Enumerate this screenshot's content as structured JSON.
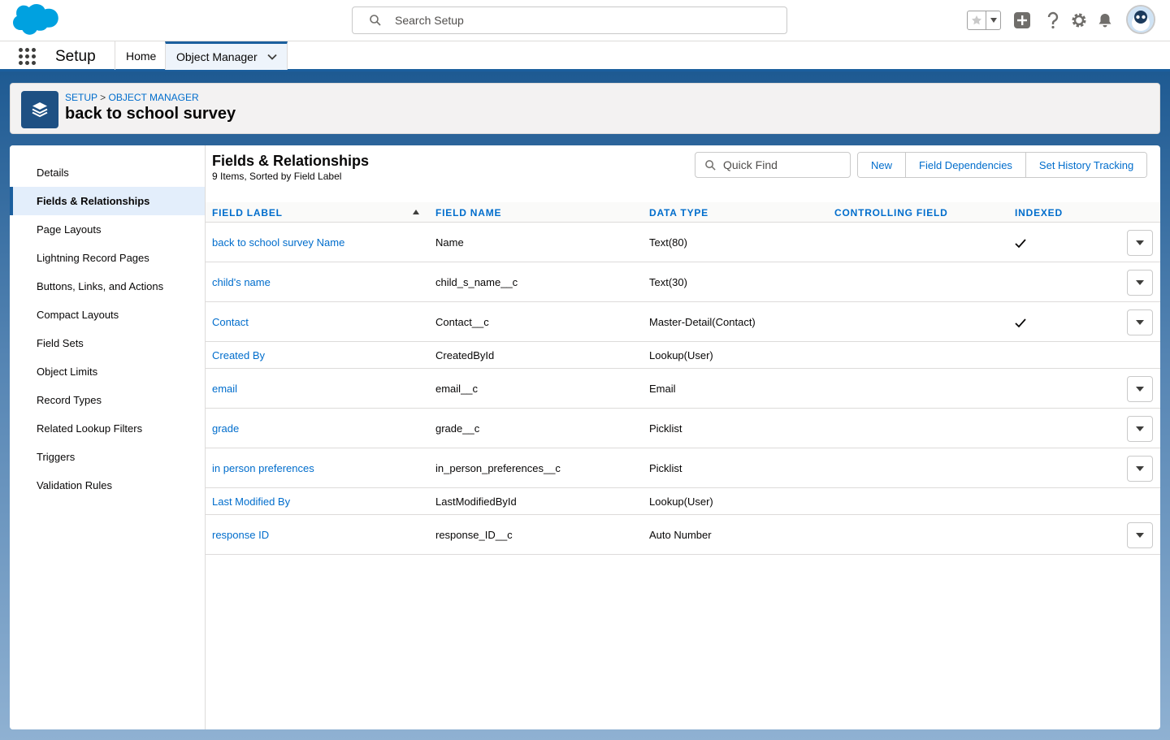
{
  "header": {
    "search_placeholder": "Search Setup"
  },
  "context": {
    "app_name": "Setup",
    "tabs": [
      "Home",
      "Object Manager"
    ]
  },
  "object_header": {
    "breadcrumb": [
      "SETUP",
      "OBJECT MANAGER"
    ],
    "breadcrumb_sep": ">",
    "title": "back to school survey"
  },
  "sidebar": {
    "items": [
      "Details",
      "Fields & Relationships",
      "Page Layouts",
      "Lightning Record Pages",
      "Buttons, Links, and Actions",
      "Compact Layouts",
      "Field Sets",
      "Object Limits",
      "Record Types",
      "Related Lookup Filters",
      "Triggers",
      "Validation Rules"
    ],
    "active_index": 1
  },
  "content": {
    "title": "Fields & Relationships",
    "subtitle": "9 Items, Sorted by Field Label",
    "quick_find_placeholder": "Quick Find",
    "buttons": [
      "New",
      "Field Dependencies",
      "Set History Tracking"
    ]
  },
  "table": {
    "columns": [
      "FIELD LABEL",
      "FIELD NAME",
      "DATA TYPE",
      "CONTROLLING FIELD",
      "INDEXED"
    ],
    "rows": [
      {
        "label": "back to school survey Name",
        "name": "Name",
        "type": "Text(80)",
        "controlling": "",
        "indexed": true,
        "action": true
      },
      {
        "label": "child's name",
        "name": "child_s_name__c",
        "type": "Text(30)",
        "controlling": "",
        "indexed": false,
        "action": true
      },
      {
        "label": "Contact",
        "name": "Contact__c",
        "type": "Master-Detail(Contact)",
        "controlling": "",
        "indexed": true,
        "action": true
      },
      {
        "label": "Created By",
        "name": "CreatedById",
        "type": "Lookup(User)",
        "controlling": "",
        "indexed": false,
        "action": false
      },
      {
        "label": "email",
        "name": "email__c",
        "type": "Email",
        "controlling": "",
        "indexed": false,
        "action": true
      },
      {
        "label": "grade",
        "name": "grade__c",
        "type": "Picklist",
        "controlling": "",
        "indexed": false,
        "action": true
      },
      {
        "label": "in person preferences",
        "name": "in_person_preferences__c",
        "type": "Picklist",
        "controlling": "",
        "indexed": false,
        "action": true
      },
      {
        "label": "Last Modified By",
        "name": "LastModifiedById",
        "type": "Lookup(User)",
        "controlling": "",
        "indexed": false,
        "action": false
      },
      {
        "label": "response ID",
        "name": "response_ID__c",
        "type": "Auto Number",
        "controlling": "",
        "indexed": false,
        "action": true
      }
    ]
  }
}
